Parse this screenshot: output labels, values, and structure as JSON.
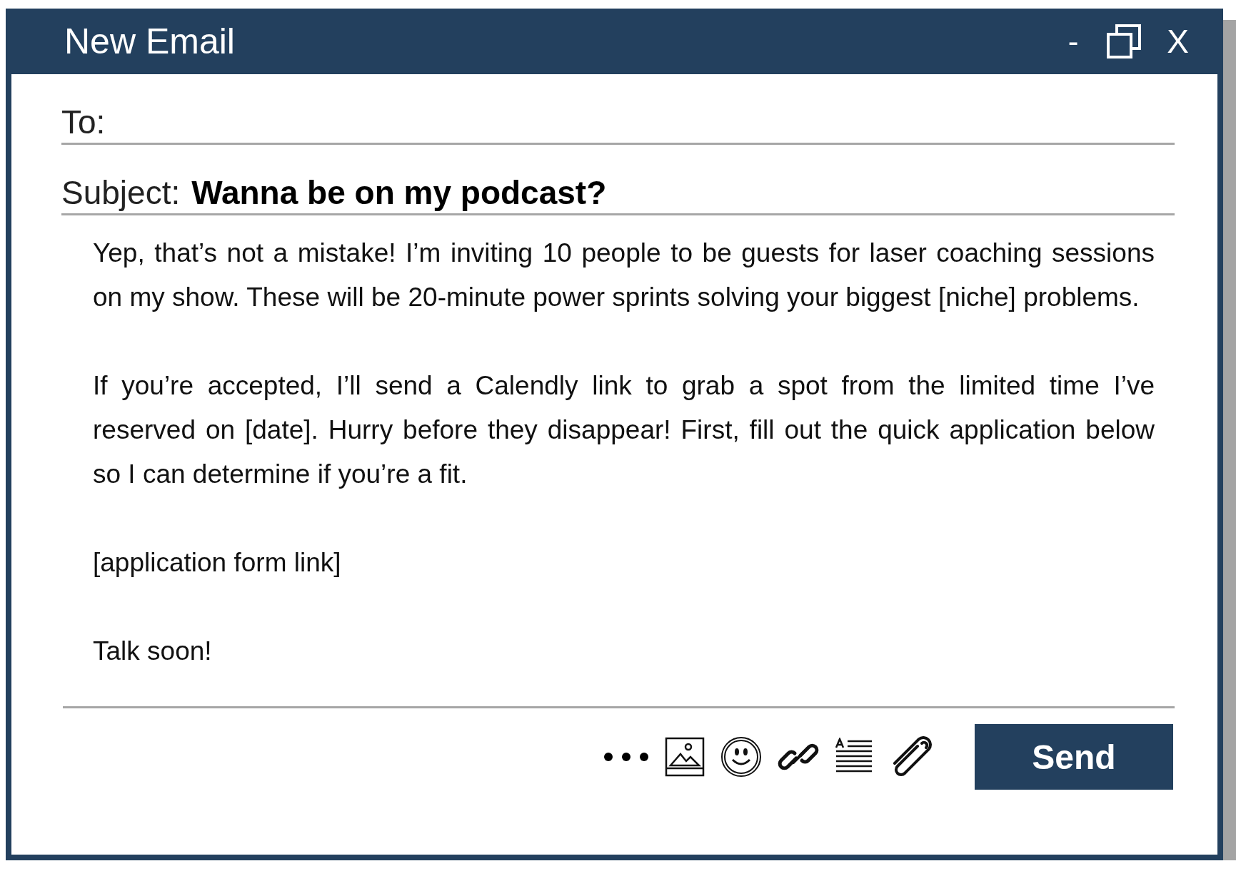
{
  "window": {
    "title": "New Email",
    "minimize": "-",
    "close": "X"
  },
  "to": {
    "label": "To:"
  },
  "subject": {
    "label": "Subject:",
    "value": "Wanna be on my podcast?"
  },
  "body": [
    "Yep, that’s not a mistake! I’m inviting 10 people to be guests for laser coaching sessions on my show. These will be 20-minute power sprints solving your biggest [niche] problems.",
    "If you’re accepted, I’ll send a Calendly link to grab a spot from the limited time I’ve reserved on [date]. Hurry before they disappear! First, fill out the quick application below so I can determine if you’re a fit.",
    "[application form link]",
    "Talk soon!"
  ],
  "toolbar": {
    "send": "Send"
  }
}
